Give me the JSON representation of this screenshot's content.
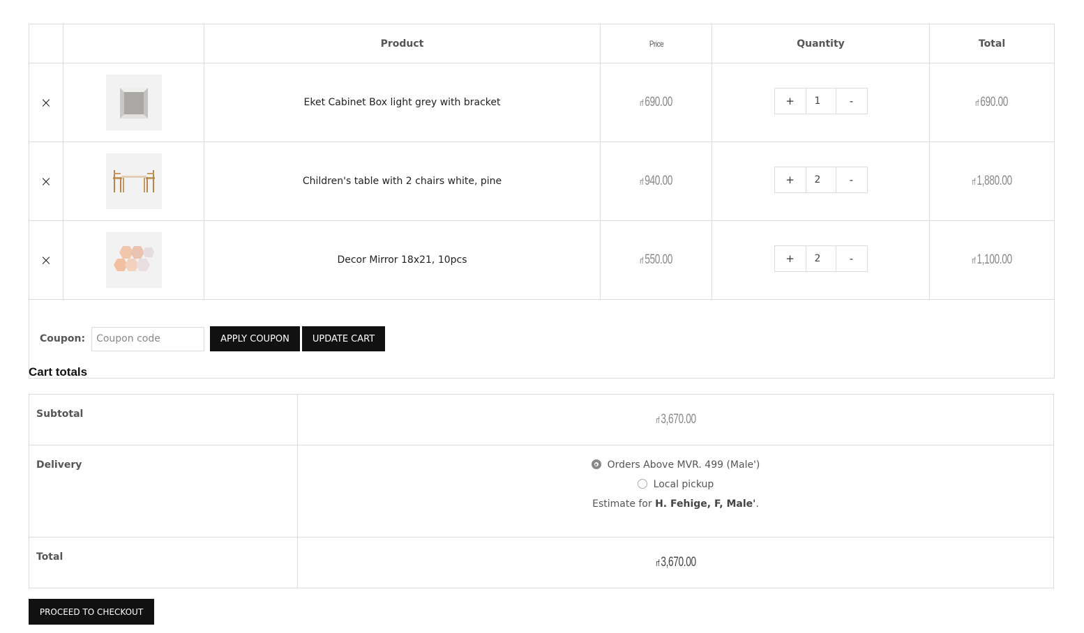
{
  "cart": {
    "headers": {
      "remove": "",
      "thumbnail": "",
      "product": "Product",
      "price": "Price",
      "quantity": "Quantity",
      "total": "Total"
    },
    "items": [
      {
        "remove": "×",
        "name": "Eket Cabinet Box light grey with bracket",
        "currency": "rf",
        "price": "690.00",
        "qty_plus": "+",
        "qty": "1",
        "qty_minus": "-",
        "subtotal": "690.00"
      },
      {
        "remove": "×",
        "name": "Children's table with 2 chairs white, pine",
        "currency": "rf",
        "price": "940.00",
        "qty_plus": "+",
        "qty": "2",
        "qty_minus": "-",
        "subtotal": "1,880.00"
      },
      {
        "remove": "×",
        "name": "Decor Mirror 18x21, 10pcs",
        "currency": "rf",
        "price": "550.00",
        "qty_plus": "+",
        "qty": "2",
        "qty_minus": "-",
        "subtotal": "1,100.00"
      }
    ],
    "coupon": {
      "label": "Coupon:",
      "placeholder": "Coupon code",
      "value": "",
      "apply_label": "APPLY COUPON"
    },
    "update_label": "UPDATE CART"
  },
  "totals": {
    "title": "Cart totals",
    "subtotal_label": "Subtotal",
    "subtotal_currency": "rf",
    "subtotal_value": "3,670.00",
    "delivery_label": "Delivery",
    "delivery_options": [
      {
        "label": "Orders Above MVR. 499 (Male')",
        "selected": true
      },
      {
        "label": "Local pickup",
        "selected": false
      }
    ],
    "estimate_prefix": "Estimate for",
    "estimate_location": "H. Fehige, F, Male'",
    "estimate_suffix": ".",
    "total_label": "Total",
    "total_currency": "rf",
    "total_value": "3,670.00"
  },
  "checkout": {
    "label": "PROCEED TO CHECKOUT"
  },
  "icons": {
    "remove": "close-icon",
    "radio_selected": "radio-checked-icon",
    "radio_unselected": "radio-unchecked-icon"
  }
}
